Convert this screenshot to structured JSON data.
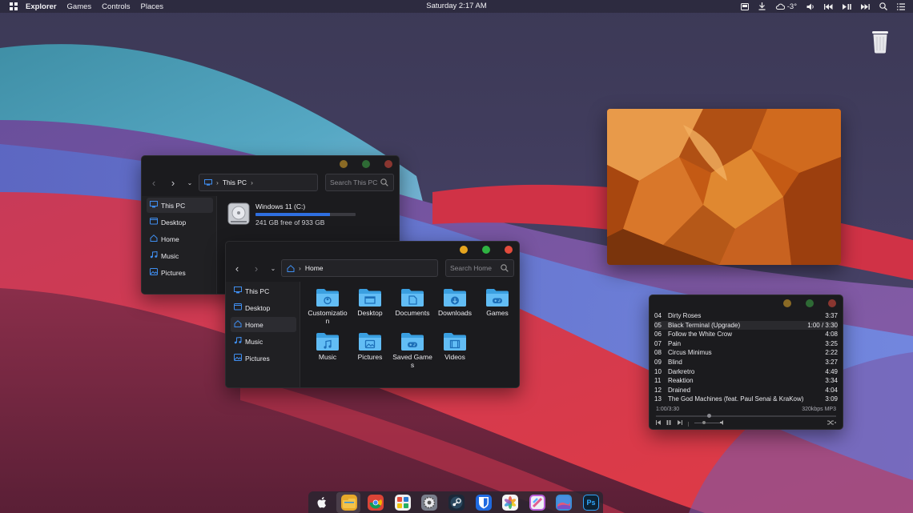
{
  "topbar": {
    "menu": [
      "Explorer",
      "Games",
      "Controls",
      "Places"
    ],
    "clock": "Saturday 2:17 AM",
    "weather": "-3°",
    "tray_icons": [
      "screenshot-icon",
      "download-icon",
      "weather-icon",
      "volume-icon",
      "previous-track-icon",
      "play-pause-icon",
      "next-track-icon",
      "search-icon",
      "notification-list-icon"
    ]
  },
  "desktop": {
    "trash_icon": "trash-icon"
  },
  "explorer_back": {
    "address": "This PC",
    "search_placeholder": "Search This PC",
    "sidebar": [
      "This PC",
      "Desktop",
      "Home",
      "Music",
      "Pictures"
    ],
    "active_sidebar": "This PC",
    "drive": {
      "name": "Windows 11 (C:)",
      "free": "241 GB free of 933 GB",
      "used_fraction": 0.74
    }
  },
  "explorer_front": {
    "address": "Home",
    "search_placeholder": "Search Home",
    "sidebar": [
      "This PC",
      "Desktop",
      "Home",
      "Music",
      "Pictures"
    ],
    "active_sidebar": "Home",
    "folders": [
      {
        "label": "Customization",
        "icon": "customization-folder-icon"
      },
      {
        "label": "Desktop",
        "icon": "desktop-folder-icon"
      },
      {
        "label": "Documents",
        "icon": "documents-folder-icon"
      },
      {
        "label": "Downloads",
        "icon": "downloads-folder-icon"
      },
      {
        "label": "Games",
        "icon": "games-folder-icon"
      },
      {
        "label": "Music",
        "icon": "music-folder-icon"
      },
      {
        "label": "Pictures",
        "icon": "pictures-folder-icon"
      },
      {
        "label": "Saved Games",
        "icon": "saved-games-folder-icon"
      },
      {
        "label": "Videos",
        "icon": "videos-folder-icon"
      }
    ]
  },
  "player": {
    "tracks": [
      {
        "n": "04",
        "title": "Dirty Roses",
        "dur": "3:37"
      },
      {
        "n": "05",
        "title": "Black Terminal (Upgrade)",
        "dur": "1:00 / 3:30",
        "current": true
      },
      {
        "n": "06",
        "title": "Follow the White Crow",
        "dur": "4:08"
      },
      {
        "n": "07",
        "title": "Pain",
        "dur": "3:25"
      },
      {
        "n": "08",
        "title": "Circus Minimus",
        "dur": "2:22"
      },
      {
        "n": "09",
        "title": "Blind",
        "dur": "3:27"
      },
      {
        "n": "10",
        "title": "Darkretro",
        "dur": "4:49"
      },
      {
        "n": "11",
        "title": "Reaktion",
        "dur": "3:34"
      },
      {
        "n": "12",
        "title": "Drained",
        "dur": "4:04"
      },
      {
        "n": "13",
        "title": "The God Machines (feat. Paul Senai & KraKow)",
        "dur": "3:09"
      }
    ],
    "position": "1:00/3:30",
    "format": "320kbps MP3",
    "progress_fraction": 0.29,
    "controls": [
      "prev-icon",
      "pause-icon",
      "next-icon",
      "volume-slider",
      "volume-icon",
      "shuffle-icon"
    ]
  },
  "dock": {
    "apps": [
      {
        "name": "apple-icon",
        "color": "#3a3844"
      },
      {
        "name": "file-explorer-icon",
        "color": "#e8a92a"
      },
      {
        "name": "chrome-icon",
        "color": "#db4437"
      },
      {
        "name": "office-icon",
        "color": "#f0f0f0"
      },
      {
        "name": "settings-icon",
        "color": "#7a7f8c"
      },
      {
        "name": "steam-icon",
        "color": "#1b2838"
      },
      {
        "name": "bitwarden-icon",
        "color": "#1f6ae0"
      },
      {
        "name": "photos-icon",
        "color": "#f5f5f5"
      },
      {
        "name": "paint-icon",
        "color": "#b85fd9"
      },
      {
        "name": "wallpaper-icon",
        "color": "#3a8ed8"
      },
      {
        "name": "photoshop-icon",
        "color": "#0d2233",
        "text": "Ps"
      }
    ]
  }
}
